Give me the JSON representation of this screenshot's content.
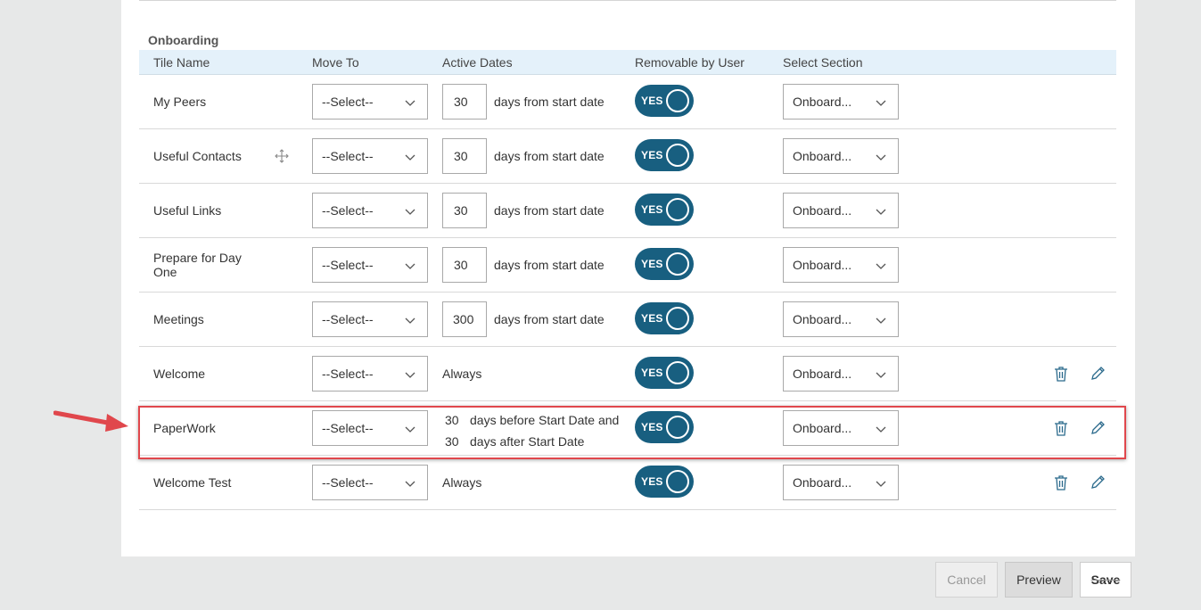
{
  "section": {
    "title": "Onboarding"
  },
  "columns": {
    "tile_name": "Tile Name",
    "move_to": "Move To",
    "active_dates": "Active Dates",
    "removable": "Removable by User",
    "select_section": "Select Section"
  },
  "rows": [
    {
      "name": "My Peers",
      "move_to": "--Select--",
      "days": "30",
      "days_text": "days from start date",
      "toggle": "YES",
      "section": "Onboard..."
    },
    {
      "name": "Useful Contacts",
      "move_to": "--Select--",
      "days": "30",
      "days_text": "days from start date",
      "toggle": "YES",
      "section": "Onboard..."
    },
    {
      "name": "Useful Links",
      "move_to": "--Select--",
      "days": "30",
      "days_text": "days from start date",
      "toggle": "YES",
      "section": "Onboard..."
    },
    {
      "name": "Prepare for Day One",
      "move_to": "--Select--",
      "days": "30",
      "days_text": "days from start date",
      "toggle": "YES",
      "section": "Onboard..."
    },
    {
      "name": "Meetings",
      "move_to": "--Select--",
      "days": "300",
      "days_text": "days from start date",
      "toggle": "YES",
      "section": "Onboard..."
    },
    {
      "name": "Welcome",
      "move_to": "--Select--",
      "always": "Always",
      "toggle": "YES",
      "section": "Onboard..."
    },
    {
      "name": "PaperWork",
      "move_to": "--Select--",
      "before_days": "30",
      "before_text": "days before Start Date and",
      "after_days": "30",
      "after_text": "days after Start Date",
      "toggle": "YES",
      "section": "Onboard..."
    },
    {
      "name": "Welcome Test",
      "move_to": "--Select--",
      "always": "Always",
      "toggle": "YES",
      "section": "Onboard..."
    }
  ],
  "footer": {
    "cancel": "Cancel",
    "preview": "Preview",
    "save": "Save"
  },
  "colors": {
    "toggle_on": "#185f80",
    "header_bg": "#e4f1fa",
    "highlight": "#e0474c"
  },
  "icons": {
    "move": "move-arrows-icon",
    "dropdown": "chevron-down-icon",
    "delete": "trash-icon",
    "edit": "pencil-icon",
    "annotation": "red-arrow-icon"
  }
}
